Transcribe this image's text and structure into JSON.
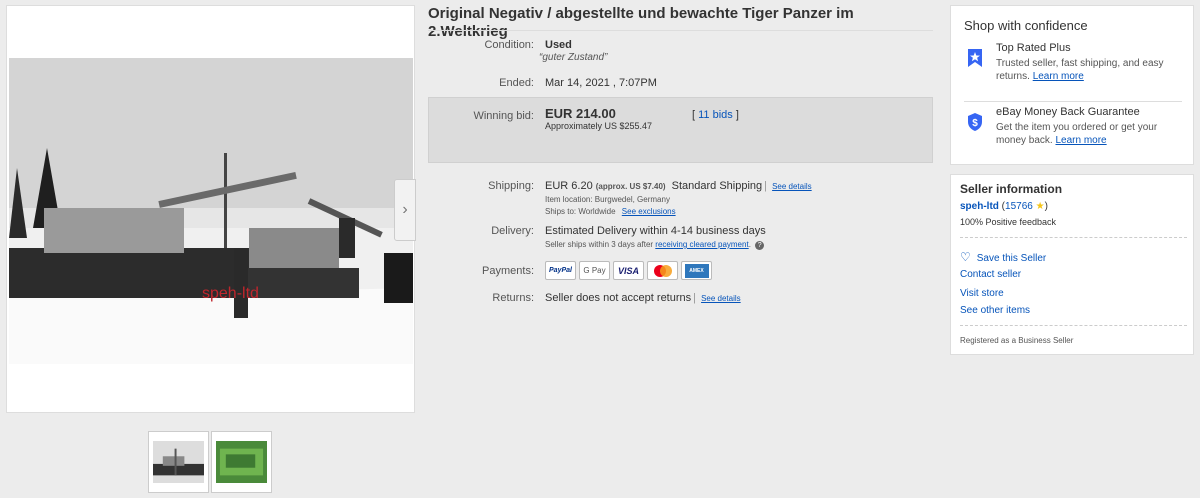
{
  "listing": {
    "title": "Original Negativ / abgestellte und bewachte Tiger Panzer im 2.Weltkrieg",
    "condition_label": "Condition:",
    "condition_value": "Used",
    "condition_note": "guter Zustand",
    "ended_label": "Ended:",
    "ended_value": "Mar 14, 2021 , 7:07PM",
    "winning_bid_label": "Winning bid:",
    "winning_bid_value": "EUR 214.00",
    "winning_bid_approx": "Approximately US $255.47",
    "bids_count": "11 bids",
    "shipping_label": "Shipping:",
    "shipping_value": "EUR 6.20",
    "shipping_approx": "(approx. US $7.40)",
    "shipping_service": "Standard Shipping",
    "see_details": "See details",
    "item_location": "Item location:  Burgwedel, Germany",
    "ships_to": "Ships to:  Worldwide",
    "see_exclusions": "See exclusions",
    "delivery_label": "Delivery:",
    "delivery_value": "Estimated Delivery within 4-14 business days",
    "delivery_note": "Seller ships within 3 days after",
    "receiving_payment": "receiving cleared payment",
    "payments_label": "Payments:",
    "payment_methods": [
      "PayPal",
      "G Pay",
      "VISA",
      "Mastercard",
      "AMEX"
    ],
    "returns_label": "Returns:",
    "returns_value": "Seller does not accept returns",
    "returns_see_details": "See details"
  },
  "image": {
    "watermark": "speh-ltd"
  },
  "shop_confidence": {
    "heading": "Shop with confidence",
    "items": [
      {
        "icon": "top-rated-badge-icon",
        "title": "Top Rated Plus",
        "text": "Trusted seller, fast shipping, and easy returns.",
        "link": "Learn more"
      },
      {
        "icon": "shield-dollar-icon",
        "title": "eBay Money Back Guarantee",
        "text": "Get the item you ordered or get your money back.",
        "link": "Learn more"
      }
    ]
  },
  "seller": {
    "heading": "Seller information",
    "name": "speh-ltd",
    "feedback_count": "15766",
    "positive": "100% Positive feedback",
    "save": "Save this Seller",
    "contact": "Contact seller",
    "store": "Visit store",
    "other_items": "See other items",
    "registered": "Registered as a Business Seller"
  },
  "colors": {
    "link": "#0654ba",
    "winning_box": "#dcdcdc",
    "star": "#f5c518",
    "watermark": "#c0262d"
  }
}
